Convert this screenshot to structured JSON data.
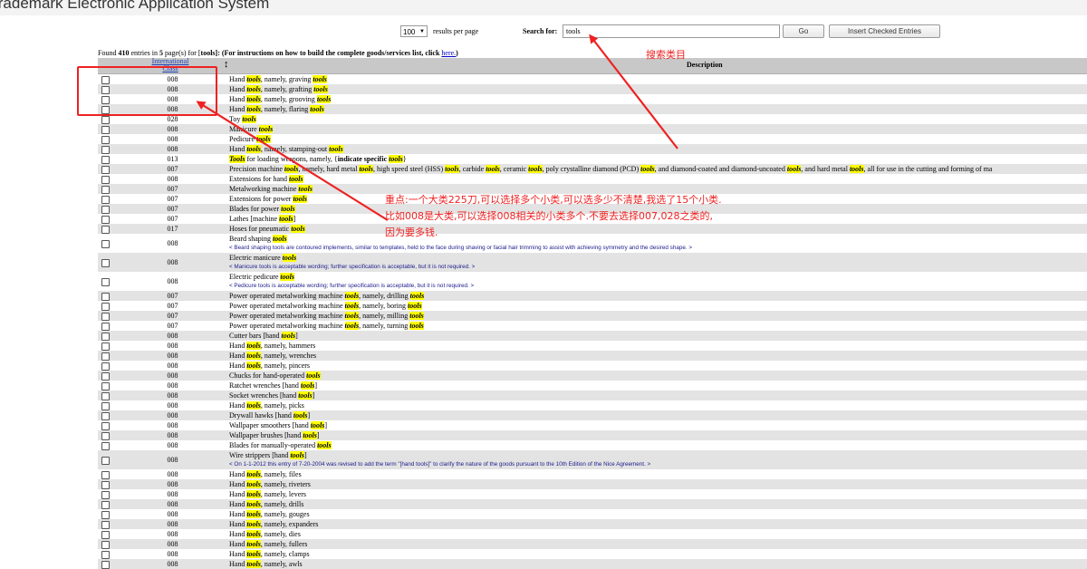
{
  "app": {
    "title": "Trademark Electronic Application System"
  },
  "toolbar": {
    "per_page_value": "100",
    "per_page_label": "results per page",
    "search_label": "Search for:",
    "search_value": "tools",
    "go_label": "Go",
    "insert_label": "Insert Checked Entries"
  },
  "found": {
    "prefix": "Found",
    "count": "410",
    "mid1": "entries in",
    "pages": "5",
    "mid2": "page(s) for [",
    "term": "tools",
    "mid3": "]: (For instructions on how to build the complete goods/services list, click",
    "link": "here.",
    "suffix": ")"
  },
  "table": {
    "header_class": "International Class",
    "header_sort": "↕",
    "header_desc": "Description",
    "rows": [
      {
        "cls": "008",
        "segs": [
          [
            "Hand ",
            0
          ],
          [
            "tools",
            1
          ],
          [
            ", namely, graving ",
            0
          ],
          [
            "tools",
            1
          ]
        ]
      },
      {
        "cls": "008",
        "segs": [
          [
            "Hand ",
            0
          ],
          [
            "tools",
            1
          ],
          [
            ", namely, grafting ",
            0
          ],
          [
            "tools",
            1
          ]
        ]
      },
      {
        "cls": "008",
        "segs": [
          [
            "Hand ",
            0
          ],
          [
            "tools",
            1
          ],
          [
            ", namely, grooving ",
            0
          ],
          [
            "tools",
            1
          ]
        ]
      },
      {
        "cls": "008",
        "segs": [
          [
            "Hand ",
            0
          ],
          [
            "tools",
            1
          ],
          [
            ", namely, flaring ",
            0
          ],
          [
            "tools",
            1
          ]
        ]
      },
      {
        "cls": "028",
        "segs": [
          [
            "Toy ",
            0
          ],
          [
            "tools",
            1
          ]
        ]
      },
      {
        "cls": "008",
        "segs": [
          [
            "Manicure ",
            0
          ],
          [
            "tools",
            1
          ]
        ]
      },
      {
        "cls": "008",
        "segs": [
          [
            "Pedicure ",
            0
          ],
          [
            "tools",
            1
          ]
        ]
      },
      {
        "cls": "008",
        "segs": [
          [
            "Hand ",
            0
          ],
          [
            "tools",
            1
          ],
          [
            ", namely, stamping-out ",
            0
          ],
          [
            "tools",
            1
          ]
        ]
      },
      {
        "cls": "013",
        "segs": [
          [
            "Tools",
            1
          ],
          [
            " for loading weapons, namely, {",
            0
          ],
          [
            "indicate specific ",
            2
          ],
          [
            "tools",
            1
          ],
          [
            "}",
            0
          ]
        ]
      },
      {
        "cls": "007",
        "segs": [
          [
            "Precision machine ",
            0
          ],
          [
            "tools",
            1
          ],
          [
            ", namely, hard metal ",
            0
          ],
          [
            "tools",
            1
          ],
          [
            ", high speed steel (HSS) ",
            0
          ],
          [
            "tools",
            1
          ],
          [
            ", carbide ",
            0
          ],
          [
            "tools",
            1
          ],
          [
            ", ceramic ",
            0
          ],
          [
            "tools",
            1
          ],
          [
            ", poly crystalline diamond (PCD) ",
            0
          ],
          [
            "tools",
            1
          ],
          [
            ", and diamond-coated and diamond-uncoated ",
            0
          ],
          [
            "tools",
            1
          ],
          [
            ", and hard metal ",
            0
          ],
          [
            "tools",
            1
          ],
          [
            ", all for use in the cutting and forming of ma",
            0
          ]
        ]
      },
      {
        "cls": "008",
        "segs": [
          [
            "Extensions for hand ",
            0
          ],
          [
            "tools",
            1
          ]
        ]
      },
      {
        "cls": "007",
        "segs": [
          [
            "Metalworking machine ",
            0
          ],
          [
            "tools",
            1
          ]
        ]
      },
      {
        "cls": "007",
        "segs": [
          [
            "Extensions for power ",
            0
          ],
          [
            "tools",
            1
          ]
        ]
      },
      {
        "cls": "007",
        "segs": [
          [
            "Blades for power ",
            0
          ],
          [
            "tools",
            1
          ]
        ]
      },
      {
        "cls": "007",
        "segs": [
          [
            "Lathes [machine ",
            0
          ],
          [
            "tools",
            1
          ],
          [
            "]",
            0
          ]
        ]
      },
      {
        "cls": "017",
        "segs": [
          [
            "Hoses for pneumatic ",
            0
          ],
          [
            "tools",
            1
          ]
        ]
      },
      {
        "cls": "008",
        "segs": [
          [
            "Beard shaping ",
            0
          ],
          [
            "tools",
            1
          ]
        ],
        "note": "< Beard shaping tools are contoured implements, similar to templates, held to the face during shaving or facial hair trimming to assist with achieving symmetry and the desired shape. >"
      },
      {
        "cls": "008",
        "segs": [
          [
            "Electric manicure ",
            0
          ],
          [
            "tools",
            1
          ]
        ],
        "note": "< Manicure tools is acceptable wording; further specification is acceptable, but it is not required. >"
      },
      {
        "cls": "008",
        "segs": [
          [
            "Electric pedicure ",
            0
          ],
          [
            "tools",
            1
          ]
        ],
        "note": "< Pedicure tools is acceptable wording; further specification is acceptable, but it is not required. >"
      },
      {
        "cls": "007",
        "segs": [
          [
            "Power operated metalworking machine ",
            0
          ],
          [
            "tools",
            1
          ],
          [
            ", namely, drilling ",
            0
          ],
          [
            "tools",
            1
          ]
        ]
      },
      {
        "cls": "007",
        "segs": [
          [
            "Power operated metalworking machine ",
            0
          ],
          [
            "tools",
            1
          ],
          [
            ", namely, boring ",
            0
          ],
          [
            "tools",
            1
          ]
        ]
      },
      {
        "cls": "007",
        "segs": [
          [
            "Power operated metalworking machine ",
            0
          ],
          [
            "tools",
            1
          ],
          [
            ", namely, milling ",
            0
          ],
          [
            "tools",
            1
          ]
        ]
      },
      {
        "cls": "007",
        "segs": [
          [
            "Power operated metalworking machine ",
            0
          ],
          [
            "tools",
            1
          ],
          [
            ", namely, turning ",
            0
          ],
          [
            "tools",
            1
          ]
        ]
      },
      {
        "cls": "008",
        "segs": [
          [
            "Cutter bars [hand ",
            0
          ],
          [
            "tools",
            1
          ],
          [
            "]",
            0
          ]
        ]
      },
      {
        "cls": "008",
        "segs": [
          [
            "Hand ",
            0
          ],
          [
            "tools",
            1
          ],
          [
            ", namely, hammers",
            0
          ]
        ]
      },
      {
        "cls": "008",
        "segs": [
          [
            "Hand ",
            0
          ],
          [
            "tools",
            1
          ],
          [
            ", namely, wrenches",
            0
          ]
        ]
      },
      {
        "cls": "008",
        "segs": [
          [
            "Hand ",
            0
          ],
          [
            "tools",
            1
          ],
          [
            ", namely, pincers",
            0
          ]
        ]
      },
      {
        "cls": "008",
        "segs": [
          [
            "Chucks for hand-operated ",
            0
          ],
          [
            "tools",
            1
          ]
        ]
      },
      {
        "cls": "008",
        "segs": [
          [
            "Ratchet wrenches [hand ",
            0
          ],
          [
            "tools",
            1
          ],
          [
            "]",
            0
          ]
        ]
      },
      {
        "cls": "008",
        "segs": [
          [
            "Socket wrenches [hand ",
            0
          ],
          [
            "tools",
            1
          ],
          [
            "]",
            0
          ]
        ]
      },
      {
        "cls": "008",
        "segs": [
          [
            "Hand ",
            0
          ],
          [
            "tools",
            1
          ],
          [
            ", namely, picks",
            0
          ]
        ]
      },
      {
        "cls": "008",
        "segs": [
          [
            "Drywall hawks [hand ",
            0
          ],
          [
            "tools",
            1
          ],
          [
            "]",
            0
          ]
        ]
      },
      {
        "cls": "008",
        "segs": [
          [
            "Wallpaper smoothers [hand ",
            0
          ],
          [
            "tools",
            1
          ],
          [
            "]",
            0
          ]
        ]
      },
      {
        "cls": "008",
        "segs": [
          [
            "Wallpaper brushes [hand ",
            0
          ],
          [
            "tools",
            1
          ],
          [
            "]",
            0
          ]
        ]
      },
      {
        "cls": "008",
        "segs": [
          [
            "Blades for manually-operated ",
            0
          ],
          [
            "tools",
            1
          ]
        ]
      },
      {
        "cls": "008",
        "segs": [
          [
            "Wire strippers [hand ",
            0
          ],
          [
            "tools",
            1
          ],
          [
            "]",
            0
          ]
        ],
        "note": "< On 1-1-2012 this entry of 7-20-2004 was revised to add the term \"[hand tools]\" to clarify the nature of the goods pursuant to the 10th Edition of the Nice Agreement. >"
      },
      {
        "cls": "008",
        "segs": [
          [
            "Hand ",
            0
          ],
          [
            "tools",
            1
          ],
          [
            ", namely, files",
            0
          ]
        ]
      },
      {
        "cls": "008",
        "segs": [
          [
            "Hand ",
            0
          ],
          [
            "tools",
            1
          ],
          [
            ", namely, riveters",
            0
          ]
        ]
      },
      {
        "cls": "008",
        "segs": [
          [
            "Hand ",
            0
          ],
          [
            "tools",
            1
          ],
          [
            ", namely, levers",
            0
          ]
        ]
      },
      {
        "cls": "008",
        "segs": [
          [
            "Hand ",
            0
          ],
          [
            "tools",
            1
          ],
          [
            ", namely, drills",
            0
          ]
        ]
      },
      {
        "cls": "008",
        "segs": [
          [
            "Hand ",
            0
          ],
          [
            "tools",
            1
          ],
          [
            ", namely, gouges",
            0
          ]
        ]
      },
      {
        "cls": "008",
        "segs": [
          [
            "Hand ",
            0
          ],
          [
            "tools",
            1
          ],
          [
            ", namely, expanders",
            0
          ]
        ]
      },
      {
        "cls": "008",
        "segs": [
          [
            "Hand ",
            0
          ],
          [
            "tools",
            1
          ],
          [
            ", namely, dies",
            0
          ]
        ]
      },
      {
        "cls": "008",
        "segs": [
          [
            "Hand ",
            0
          ],
          [
            "tools",
            1
          ],
          [
            ", namely, fullers",
            0
          ]
        ]
      },
      {
        "cls": "008",
        "segs": [
          [
            "Hand ",
            0
          ],
          [
            "tools",
            1
          ],
          [
            ", namely, clamps",
            0
          ]
        ]
      },
      {
        "cls": "008",
        "segs": [
          [
            "Hand ",
            0
          ],
          [
            "tools",
            1
          ],
          [
            ", namely, awls",
            0
          ]
        ]
      }
    ]
  },
  "annotations": {
    "search_note": "搜索类目",
    "key_note_lines": [
      "重点:一个大类225刀,可以选择多个小类,可以选多少不清楚,我选了15个小类.",
      "比如008是大类,可以选择008相关的小类多个.不要去选择007,028之类的,",
      "因为要多钱."
    ],
    "color": "#ee2222"
  }
}
